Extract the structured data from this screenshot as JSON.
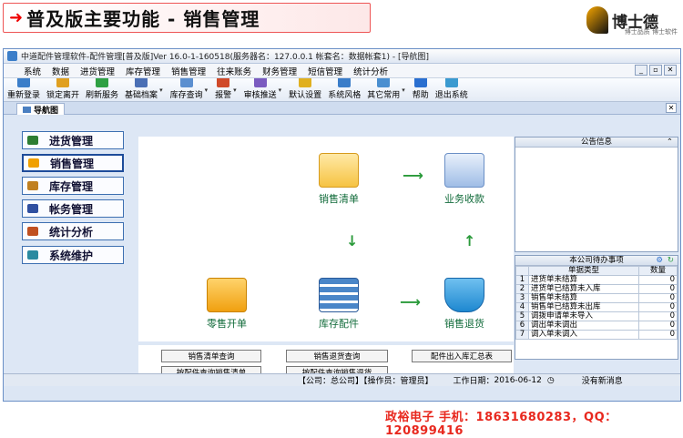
{
  "banner": {
    "title": "普及版主要功能 - 销售管理"
  },
  "logo": {
    "name": "博士德",
    "sub": "博士品质 博士软件"
  },
  "window": {
    "title": "中道配件管理软件-配件管理[普及版]Ver 16.0-1-160518(服务器名：127.0.0.1 帐套名：数据帐套1) - [导航图]"
  },
  "menu": [
    "系统",
    "数据",
    "进货管理",
    "库存管理",
    "销售管理",
    "往来账务",
    "财务管理",
    "短信管理",
    "统计分析"
  ],
  "toolbar": [
    {
      "label": "重新登录",
      "color": "#3b7ec9"
    },
    {
      "label": "锁定离开",
      "color": "#e0a020"
    },
    {
      "label": "刷新服务",
      "color": "#2ea043"
    },
    {
      "label": "基础档案",
      "color": "#4a6fb5",
      "dd": true
    },
    {
      "label": "库存查询",
      "color": "#5b8fd0",
      "dd": true
    },
    {
      "label": "报警",
      "color": "#d04a2a",
      "dd": true
    },
    {
      "label": "审核推送",
      "color": "#7a5bc0",
      "dd": true
    },
    {
      "label": "默认设置",
      "color": "#e0b020"
    },
    {
      "label": "系统风格",
      "color": "#3a7dc9"
    },
    {
      "label": "其它常用",
      "color": "#4a8fd0",
      "dd": true
    },
    {
      "label": "帮助",
      "color": "#2a6fd0"
    },
    {
      "label": "退出系统",
      "color": "#3a9ad0"
    }
  ],
  "tab": {
    "label": "导航图"
  },
  "sidebar": [
    {
      "label": "进货管理",
      "color": "#2e7d32"
    },
    {
      "label": "销售管理",
      "color": "#f0a000"
    },
    {
      "label": "库存管理",
      "color": "#c08020"
    },
    {
      "label": "帐务管理",
      "color": "#3050a0"
    },
    {
      "label": "统计分析",
      "color": "#c05020"
    },
    {
      "label": "系统维护",
      "color": "#2a8aa0"
    }
  ],
  "flow": {
    "nodes": [
      "销售清单",
      "业务收款",
      "零售开单",
      "库存配件",
      "销售退货"
    ]
  },
  "quick": [
    "销售清单查询",
    "销售退货查询",
    "配件出入库汇总表",
    "按配件查询销售清单",
    "按配件查询销售退货"
  ],
  "announce": {
    "title": "公告信息"
  },
  "todo": {
    "title": "本公司待办事项",
    "col_type": "单据类型",
    "col_qty": "数量",
    "rows": [
      {
        "no": "1",
        "type": "进货单未结算",
        "qty": "0"
      },
      {
        "no": "2",
        "type": "进货单已结算未入库",
        "qty": "0"
      },
      {
        "no": "3",
        "type": "销售单未结算",
        "qty": "0"
      },
      {
        "no": "4",
        "type": "销售单已结算未出库",
        "qty": "0"
      },
      {
        "no": "5",
        "type": "调拨申请单未导入",
        "qty": "0"
      },
      {
        "no": "6",
        "type": "调出单未调出",
        "qty": "0"
      },
      {
        "no": "7",
        "type": "调入单未调入",
        "qty": "0"
      }
    ]
  },
  "status": {
    "company": "【公司：总公司】【操作员：管理员】",
    "date_label": "工作日期：",
    "date": "2016-06-12",
    "msg": "没有新消息"
  },
  "footer": {
    "text": "政裕电子  手机：18631680283，QQ：120899416"
  }
}
